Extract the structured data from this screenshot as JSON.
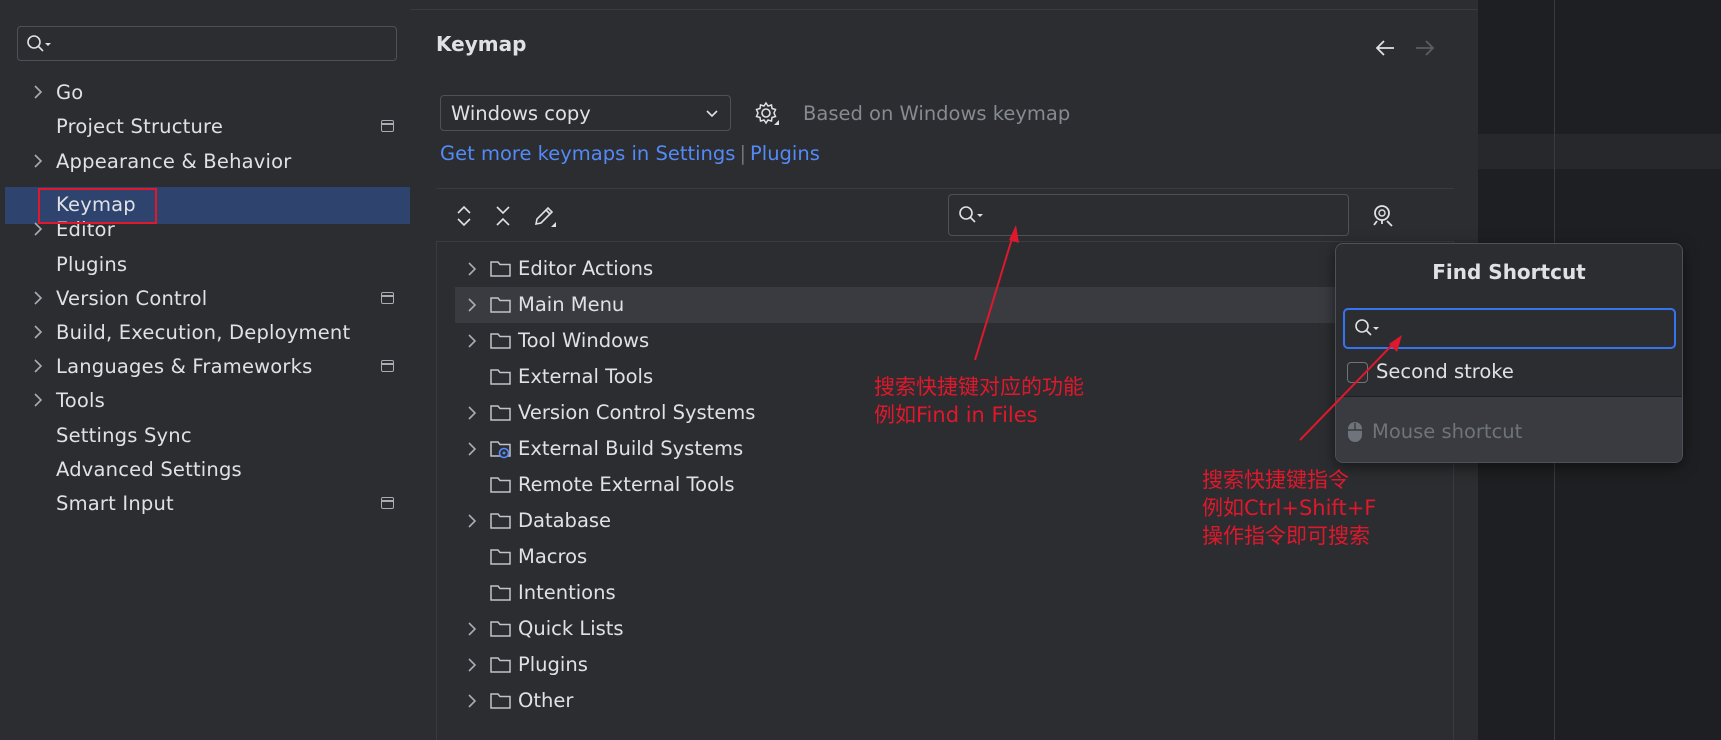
{
  "sidebar": {
    "search": {
      "placeholder": ""
    },
    "items": [
      {
        "label": "Go"
      },
      {
        "label": "Project Structure"
      },
      {
        "label": "Appearance & Behavior"
      },
      {
        "label": "Keymap"
      },
      {
        "label": "Editor"
      },
      {
        "label": "Plugins"
      },
      {
        "label": "Version Control"
      },
      {
        "label": "Build, Execution, Deployment"
      },
      {
        "label": "Languages & Frameworks"
      },
      {
        "label": "Tools"
      },
      {
        "label": "Settings Sync"
      },
      {
        "label": "Advanced Settings"
      },
      {
        "label": "Smart Input"
      }
    ]
  },
  "main": {
    "title": "Keymap",
    "keymap_select": {
      "value": "Windows copy"
    },
    "based_on": "Based on Windows keymap",
    "links": {
      "part1": "Get more keymaps in Settings",
      "separator": "|",
      "part2": "Plugins"
    },
    "tree_search": {
      "placeholder": ""
    },
    "tree": [
      {
        "label": "Editor Actions"
      },
      {
        "label": "Main Menu"
      },
      {
        "label": "Tool Windows"
      },
      {
        "label": "External Tools"
      },
      {
        "label": "Version Control Systems"
      },
      {
        "label": "External Build Systems"
      },
      {
        "label": "Remote External Tools"
      },
      {
        "label": "Database"
      },
      {
        "label": "Macros"
      },
      {
        "label": "Intentions"
      },
      {
        "label": "Quick Lists"
      },
      {
        "label": "Plugins"
      },
      {
        "label": "Other"
      }
    ]
  },
  "find_shortcut": {
    "title": "Find Shortcut",
    "input_placeholder": "",
    "second_stroke_label": "Second stroke",
    "mouse_shortcut_label": "Mouse shortcut"
  },
  "annotations": {
    "search_function_line1": "搜索快捷键对应的功能",
    "search_function_line2": "例如Find in Files",
    "search_shortcut_line1": "搜索快捷键指令",
    "search_shortcut_line2": "例如Ctrl+Shift+F",
    "search_shortcut_line3": "操作指令即可搜索"
  },
  "colors": {
    "background": "#2b2d30",
    "selection": "#2e436e",
    "link": "#548af7",
    "focus": "#3574f0",
    "annotation": "#e0182b"
  }
}
